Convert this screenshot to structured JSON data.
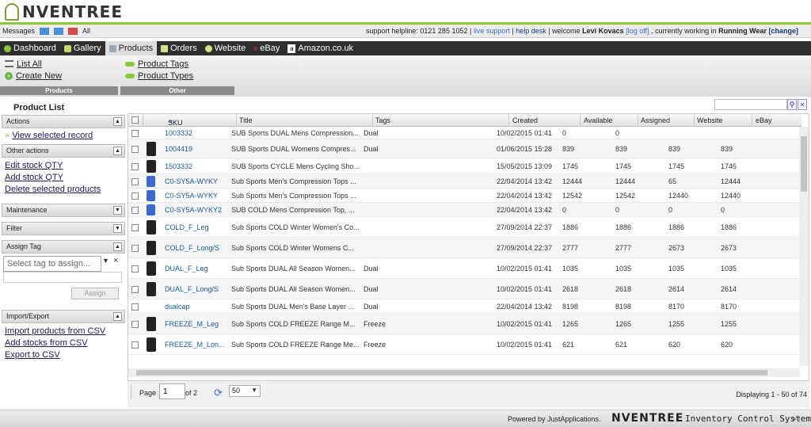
{
  "app": {
    "logo_text": "NVENTREE"
  },
  "messages": {
    "label": "Messages",
    "all": "All"
  },
  "support": {
    "text": "support helpline: 0121 285 1052 |",
    "live": "live support",
    "sep": "|",
    "help": "help desk",
    "welcome": "| welcome",
    "user": "Levi Kovacs",
    "logoff": "[log off]",
    "working": ", currently working in",
    "shop": "Running Wear",
    "change": "[change]"
  },
  "nav": {
    "tabs": [
      "Dashboard",
      "Gallery",
      "Products",
      "Orders",
      "Website",
      "eBay",
      "Amazon.co.uk"
    ]
  },
  "subnav": {
    "products": {
      "items": [
        "List All",
        "Create New"
      ],
      "label": "Products"
    },
    "other": {
      "items": [
        "Product Tags",
        "Product Types"
      ],
      "label": "Other"
    }
  },
  "product_list_title": "Product List",
  "sidebar": {
    "actions": {
      "title": "Actions",
      "link": "View selected record"
    },
    "other_actions": {
      "title": "Other actions",
      "links": [
        "Edit stock QTY",
        "Add stock QTY",
        "Delete selected products"
      ]
    },
    "maintenance": {
      "title": "Maintenance"
    },
    "filter": {
      "title": "Filter"
    },
    "assign_tag": {
      "title": "Assign Tag",
      "placeholder": "Select tag to assign...",
      "button": "Assign"
    },
    "import_export": {
      "title": "Import/Export",
      "links": [
        "Import products from CSV",
        "Add stocks from CSV",
        "Export to CSV"
      ]
    }
  },
  "grid": {
    "columns": [
      "SKU",
      "Title",
      "Tags",
      "Created",
      "Available",
      "Assigned",
      "Website",
      "eBay"
    ],
    "rows": [
      {
        "sku": "1003332",
        "title": "SUB Sports DUAL Mens Compression...",
        "tags": "Dual",
        "created": "10/02/2015 01:41",
        "available": "0",
        "assigned": "0",
        "website": "",
        "ebay": ""
      },
      {
        "sku": "1004419",
        "title": "SUB Sports DUAL Womens Compres...",
        "tags": "Dual",
        "created": "01/06/2015 15:28",
        "available": "839",
        "assigned": "839",
        "website": "839",
        "ebay": "839"
      },
      {
        "sku": "1503332",
        "title": "SUB Sports CYCLE Mens Cycling Sho...",
        "tags": "",
        "created": "15/05/2015 13:09",
        "available": "1745",
        "assigned": "1745",
        "website": "1745",
        "ebay": "1745"
      },
      {
        "sku": "C0-SY5A-WYKY",
        "title": "Sub Sports Men's Compression Tops ...",
        "tags": "",
        "created": "22/04/2014 13:42",
        "available": "12444",
        "assigned": "12444",
        "website": "65",
        "ebay": "12444"
      },
      {
        "sku": "C0-SY5A-WYKY",
        "title": "Sub Sports Men's Compression Tops ...",
        "tags": "",
        "created": "22/04/2014 13:42",
        "available": "12542",
        "assigned": "12542",
        "website": "12440",
        "ebay": "12440"
      },
      {
        "sku": "C0-SY5A-WYKY2",
        "title": "SUB COLD Mens Compression Top, ...",
        "tags": "",
        "created": "22/04/2014 13:42",
        "available": "0",
        "assigned": "0",
        "website": "0",
        "ebay": "0"
      },
      {
        "sku": "COLD_F_Leg",
        "title": "Sub Sports COLD Winter Women's Co...",
        "tags": "",
        "created": "27/09/2014 22:37",
        "available": "1886",
        "assigned": "1886",
        "website": "1886",
        "ebay": "1886"
      },
      {
        "sku": "COLD_F_Long/S",
        "title": "Sub Sports COLD Winter Womens C...",
        "tags": "",
        "created": "27/09/2014 22:37",
        "available": "2777",
        "assigned": "2777",
        "website": "2673",
        "ebay": "2673"
      },
      {
        "sku": "DUAL_F_Leg",
        "title": "Sub Sports DUAL All Season Women...",
        "tags": "Dual",
        "created": "10/02/2015 01:41",
        "available": "1035",
        "assigned": "1035",
        "website": "1035",
        "ebay": "1035"
      },
      {
        "sku": "DUAL_F_Long/S",
        "title": "Sub Sports DUAL All Season Women...",
        "tags": "Dual",
        "created": "10/02/2015 01:41",
        "available": "2618",
        "assigned": "2618",
        "website": "2614",
        "ebay": "2614"
      },
      {
        "sku": "dualcap",
        "title": "Sub Sports DUAL Men's Base Layer ...",
        "tags": "Dual",
        "created": "22/04/2014 13:42",
        "available": "8198",
        "assigned": "8198",
        "website": "8170",
        "ebay": "8170"
      },
      {
        "sku": "FREEZE_M_Leg",
        "title": "Sub Sports COLD FREEZE Range M...",
        "tags": "Freeze",
        "created": "10/02/2015 01:41",
        "available": "1265",
        "assigned": "1265",
        "website": "1255",
        "ebay": "1255"
      },
      {
        "sku": "FREEZE_M_Lon...",
        "title": "Sub Sports COLD FREEZE Range Me...",
        "tags": "Freeze",
        "created": "10/02/2015 01:41",
        "available": "621",
        "assigned": "621",
        "website": "620",
        "ebay": "620"
      }
    ]
  },
  "pager": {
    "page_label": "Page",
    "page_value": "1",
    "of": "of 2",
    "page_size": "50",
    "display": "Displaying 1 - 50 of 74"
  },
  "footer": {
    "powered": "Powered by JustApplications.",
    "brand": "NVENTREE",
    "system": "Inventory Control System",
    "right": "> !"
  }
}
